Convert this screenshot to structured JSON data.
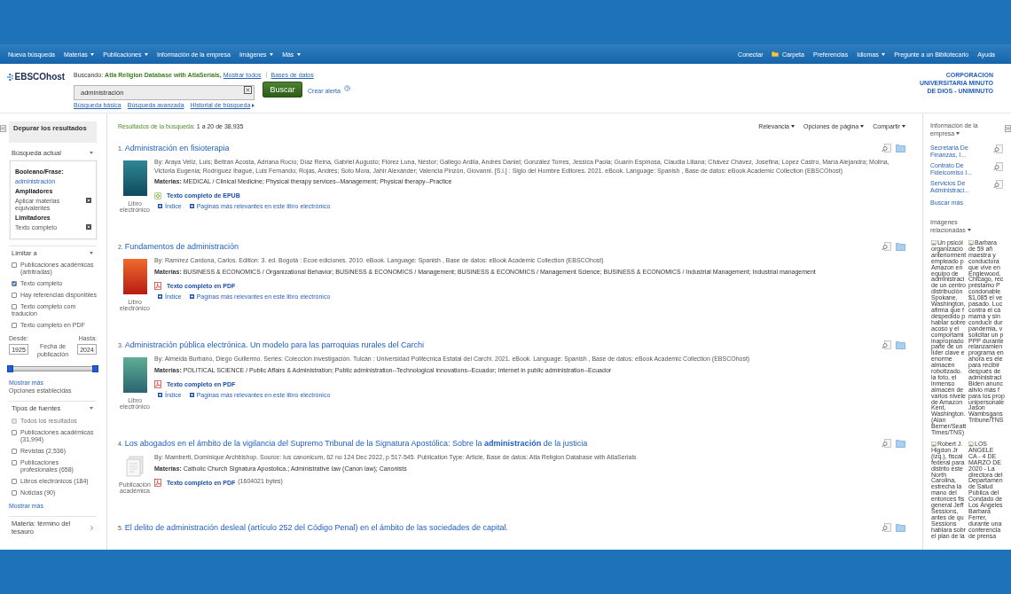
{
  "nav": {
    "left": [
      {
        "label": "Nueva búsqueda",
        "menu": false
      },
      {
        "label": "Materias",
        "menu": true
      },
      {
        "label": "Publicaciones",
        "menu": true
      },
      {
        "label": "Información de la empresa",
        "menu": false
      },
      {
        "label": "Imágenes",
        "menu": true
      },
      {
        "label": "Más",
        "menu": true
      }
    ],
    "right": [
      {
        "label": "Conectar",
        "kind": "link",
        "menu": false
      },
      {
        "label": "Carpeta",
        "kind": "folder",
        "menu": false
      },
      {
        "label": "Preferencias",
        "kind": "link",
        "menu": false
      },
      {
        "label": "Idiomas",
        "kind": "link",
        "menu": true
      },
      {
        "label": "Pregunte a un Bibliotecario",
        "kind": "link",
        "menu": false
      },
      {
        "label": "Ayuda",
        "kind": "link",
        "menu": false
      }
    ]
  },
  "header": {
    "logo": "EBSCOhost",
    "searching_label": "Buscando:",
    "database": "Atla Religion Database with AtlaSerials,",
    "show_all": "Mostrar todos",
    "databases_link": "Bases de datos",
    "search": {
      "value": "administración"
    },
    "search_button": "Buscar",
    "alert_link": "Crear alerta",
    "links": [
      {
        "label": "Búsqueda básica",
        "menu": false
      },
      {
        "label": "Búsqueda avanzada",
        "menu": false
      },
      {
        "label": "Historial de búsqueda",
        "menu": true
      }
    ],
    "institution": "CORPORACION UNIVERSITARIA MINUTO DE DIOS - UNIMINUTO"
  },
  "left_sidebar": {
    "title": "Depurar los resultados",
    "current_search": {
      "title": "Búsqueda actual",
      "expanded": true,
      "groups": [
        {
          "heading": "Booleano/Frase:",
          "items": [
            {
              "label": "administración",
              "kind": "link"
            }
          ]
        },
        {
          "heading": "Ampliadores",
          "items": [
            {
              "label": "Aplicar materias equivalentes",
              "kind": "removable"
            }
          ]
        },
        {
          "heading": "Limitadores",
          "items": [
            {
              "label": "Texto completo",
              "kind": "removable"
            }
          ]
        }
      ]
    },
    "limit_to": {
      "title": "Limitar a",
      "expanded": true,
      "options": [
        {
          "label": "Publicaciones académicas (arbitradas)",
          "kind": "hanging",
          "checked": false
        },
        {
          "label": "Texto completo",
          "kind": "hanging",
          "checked": true
        },
        {
          "label": "Hay referencias disponibles",
          "kind": "hanging",
          "checked": false
        },
        {
          "label": "Texto completo com traducion",
          "kind": "inline",
          "checked": false
        },
        {
          "label": "Texto completo en PDF",
          "kind": "hanging",
          "checked": false
        }
      ],
      "date": {
        "from_label": "Desde:",
        "from": "1925",
        "caption": "Fecha de publicación",
        "to_label": "Hasta:",
        "to": "2024",
        "level": 1
      },
      "more": "Mostrar más",
      "set_options": "Opciones establecidas"
    },
    "source_types": {
      "title": "Tipos de fuentes",
      "expanded": true,
      "options": [
        {
          "label": "Todos los resultados",
          "checked": true,
          "disabled": true
        },
        {
          "label": "Publicaciones académicas (31,994)",
          "checked": false,
          "disabled": false
        },
        {
          "label": "Revistas (2,536)",
          "checked": false,
          "disabled": false
        },
        {
          "label": "Publicaciones profesionales (658)",
          "checked": false,
          "disabled": false
        },
        {
          "label": "Libros electrónicos (184)",
          "checked": false,
          "disabled": false
        },
        {
          "label": "Noticias (90)",
          "checked": false,
          "disabled": false
        }
      ],
      "more": "Mostrar más"
    },
    "thesaurus": {
      "title": "Materia: término del tesauro",
      "expanded": false
    }
  },
  "results": {
    "summary_label": "Resultados de la búsqueda:",
    "summary": "1 a 20 de 38,935",
    "tools": [
      {
        "label": "Relevancia"
      },
      {
        "label": "Opciones de página"
      },
      {
        "label": "Compartir"
      }
    ],
    "items": [
      {
        "number": "1.",
        "title": "Administración en fisioterapia",
        "thumbnail": {
          "kind": "book",
          "caption": "Libro electrónico"
        },
        "byline": "By: Araya Veliz, Luis; Beltrán Acosta, Adriana Rocío; Díaz Reina, Gabriel Augusto; Flórez Luna, Néstor; Gallego Ardila, Andrés Daniel; González Torres, Jessica Paola; Guarín Espinosa, Claudia Liliana; Chávez Chávez, Josefina; López Castro, María Alejandra; Molina, Victoria Eugenia; Rodríguez Ibagué, Luis Fernando; Rojas, Andrés; Soto Mora, Jahir Alexánder; Valencia Pinzón, Giovanni. [S.l.] : Siglo del Hombre Editores. 2021. eBook. Language: Spanish , Base de datos: eBook Academic Collection (EBSCOhost)",
        "subjects": "**Materias:** MEDICAL / Clinical Medicine; Physical therapy services--Management; Physical therapy--Practice",
        "fulltext": {
          "kind": "epub",
          "label": "Texto completo de EPUB"
        },
        "links": [
          "Índice",
          "Paginas más relevantes en este libro electrónico"
        ]
      },
      {
        "number": "2.",
        "title": "Fundamentos de administración",
        "thumbnail": {
          "kind": "book",
          "caption": "Libro electrónico"
        },
        "byline": "By: Ramírez Cardona, Carlos. Edition: 3. ed. Bogotá : Ecoe ediciones. 2010. eBook. Language: Spanish , Base de datos: eBook Academic Collection (EBSCOhost)",
        "subjects": "**Materias:** BUSINESS & ECONOMICS / Organizational Behavior; BUSINESS & ECONOMICS / Management; BUSINESS & ECONOMICS / Management Science; BUSINESS & ECONOMICS / Industrial Management; Industrial management",
        "fulltext": {
          "kind": "pdf",
          "label": "Texto completo en PDF"
        },
        "links": [
          "Índice",
          "Paginas más relevantes en este libro electrónico"
        ]
      },
      {
        "number": "3.",
        "title": "Administración pública electrónica. Un modelo para las parroquias rurales del Carchi",
        "thumbnail": {
          "kind": "book",
          "caption": "Libro electrónico"
        },
        "byline": "By: Almeida Burbano, Diego Guillermo. Series: Colección investigación. Tulcán : Universidad Politécnica Estatal del Carchi. 2021. eBook. Language: Spanish , Base de datos: eBook Academic Collection (EBSCOhost)",
        "subjects": "**Materias:** POLITICAL SCIENCE / Public Affairs & Administration; Public administration--Technological innovations--Ecuador; Internet in public administration--Ecuador",
        "fulltext": {
          "kind": "pdf",
          "label": "Texto completo en PDF"
        },
        "links": [
          "Índice",
          "Paginas más relevantes en este libro electrónico"
        ]
      },
      {
        "number": "4.",
        "title": "Los abogados en el ámbito de la vigilancia del Supremo Tribunal de la Signatura Apostólica: Sobre la **administración** de la justicia",
        "thumbnail": {
          "kind": "article",
          "caption": "Publicación académica"
        },
        "byline": "By: Mamberti, Dominique Archbishop. Source: Ius canonicum, 62 no 124 Dec 2022, p 517-545. Publication Type: Article, Base de datos: Atla Religion Database with AtlaSerials",
        "subjects": "**Materias:** Catholic Church Signatura Apostolica.; Administrative law (Canon law); Canonists",
        "fulltext": {
          "kind": "pdf",
          "label": "Texto completo en PDF",
          "size": "(1604021 bytes)"
        }
      },
      {
        "number": "5.",
        "title": "El delito de administración desleal (artículo 252 del Código Penal) en el ámbito de las sociedades de capital."
      }
    ]
  },
  "right_sidebar": {
    "company_info": {
      "title": "Información de la empresa",
      "items": [
        "Secretaria De Finanzas, I...",
        "Contrato De Fideicomiso I...",
        "Servicios De Administraci..."
      ],
      "more": "Buscar más"
    },
    "related_images": {
      "title": "Imágenes relacionadas",
      "images": [
        {
          "lines": [
            "Un psicól",
            "organizació",
            "anteriorment",
            "empleado p",
            "Amazon en",
            "equipo de",
            "administraci",
            "de un centro",
            "distribución",
            "Spokane,",
            "Washington,",
            "afirma que f",
            "despedido p",
            "hablar sobre",
            "acoso y el",
            "comportami",
            "inapropiado",
            "parte de un",
            "líder clave e",
            "enorme",
            "almacén",
            "robotizado.",
            "la foto, el",
            "inmenso",
            "almacén de",
            "varios nivele",
            "de Amazon",
            "Kent,",
            "Washington.",
            "(Alan",
            "Berner/Seatt",
            "Times/TNS)"
          ]
        },
        {
          "lines": [
            "Barbara",
            "de 59 añ",
            "maestra y",
            "conductora",
            "que vive en",
            "Englewood,",
            "Chicago, rec",
            "préstamo P",
            "condonable",
            "$1,085 el ve",
            "pasado. Luc",
            "contra el cá",
            "mamá y sin",
            "conducir dur",
            "pandemia, v",
            "solicitar un p",
            "PPP durante",
            "relanzamien",
            "programa en",
            "ahora es ele",
            "para recibir",
            "después de",
            "administraci",
            "Biden anunc",
            "alivio más f",
            "para los prop",
            "unipersonale",
            "Jason",
            "Wambsgans",
            "Tribune/TNS"
          ]
        },
        {
          "lines": [
            "Robert J.",
            "Higdon Jr",
            "(izq.), fiscal",
            "federal para",
            "distrito este",
            "North",
            "Carolina,",
            "estrecha la",
            "mano del",
            "entonces fis",
            "general Jeff",
            "Sessions,",
            "antes de qu",
            "Sessions",
            "hablara sobr",
            "el plan de la"
          ]
        },
        {
          "lines": [
            "LOS",
            "ANGELE",
            "CA - 4 DE",
            "MARZO DE",
            "2020 - La",
            "directora del",
            "Departamen",
            "de Salud",
            "Pública del",
            "Condado de",
            "Los Ángeles",
            "Barbara",
            "Ferrer,",
            "durante una",
            "conferencia",
            "de prensa"
          ]
        }
      ]
    }
  }
}
